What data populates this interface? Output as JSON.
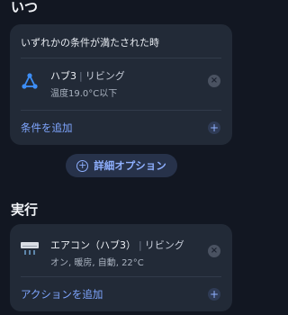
{
  "when_section": {
    "title": "いつ"
  },
  "condition_card": {
    "header": "いずれかの条件が満たされた時",
    "item": {
      "icon": "hub-icon",
      "title": "ハブ3",
      "room": "リビング",
      "subtitle": "温度19.0°C以下",
      "remove_icon": "×"
    },
    "add_label": "条件を追加",
    "add_icon": "+"
  },
  "advanced_button": {
    "label": "詳細オプション",
    "icon": "+"
  },
  "action_section": {
    "title": "実行"
  },
  "action_card": {
    "item": {
      "icon": "air-conditioner-icon",
      "title": "エアコン（ハブ3）",
      "room": "リビング",
      "subtitle": "オン, 暖房, 自動, 22°C",
      "remove_icon": "×"
    },
    "add_label": "アクションを追加",
    "add_icon": "+"
  },
  "colors": {
    "background": "#121722",
    "card": "#222a37",
    "accent": "#7fa6ff",
    "hub_icon": "#3d8ef7"
  }
}
